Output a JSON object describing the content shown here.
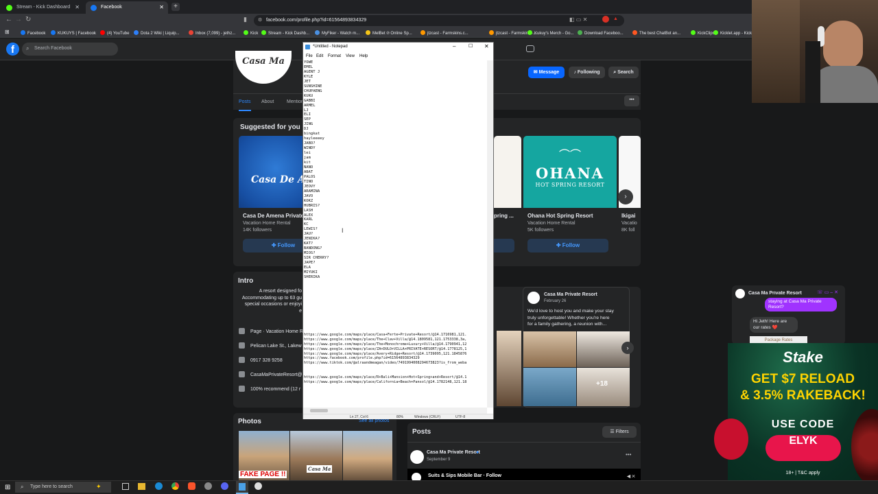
{
  "browser": {
    "tabs": [
      {
        "label": "Stream - Kick Dashboard",
        "icon": "kick-icon",
        "color": "#53fc18"
      },
      {
        "label": "Facebook",
        "icon": "facebook-icon",
        "color": "#1877f2"
      }
    ],
    "url": "facebook.com/profile.php?id=61564893834329",
    "bookmarks": [
      {
        "label": "Facebook",
        "color": "#1877f2"
      },
      {
        "label": "KUKUYS | Facebook",
        "color": "#1877f2"
      },
      {
        "label": "(4) YouTube",
        "color": "#ff0000"
      },
      {
        "label": "Dota 2 Wiki | Liquip...",
        "color": "#2d7ff9"
      },
      {
        "label": "Inbox (7,099) - jethz...",
        "color": "#ea4335"
      },
      {
        "label": "Kick",
        "color": "#53fc18"
      },
      {
        "label": "Stream - Kick Dashb...",
        "color": "#53fc18"
      },
      {
        "label": "MyFiker - Watch m...",
        "color": "#4a90e2"
      },
      {
        "label": "MelBet ℗ Online Sp...",
        "color": "#f5c518"
      },
      {
        "label": "jtzcast - Farmskins.c...",
        "color": "#ff9800"
      },
      {
        "label": "jtzcast - Farmskins -...",
        "color": "#ff9800"
      },
      {
        "label": "Kukuy's Merch - Go...",
        "color": "#53fc18"
      },
      {
        "label": "Download Faceboo...",
        "color": "#4caf50"
      },
      {
        "label": "The best ChatBot an...",
        "color": "#ff5722"
      },
      {
        "label": "KickClips",
        "color": "#53fc18"
      },
      {
        "label": "Kicklet.app - Kick C...",
        "color": "#53fc18"
      }
    ]
  },
  "facebook": {
    "search_placeholder": "Search Facebook",
    "page_avatar_text": "Casa Ma",
    "actions": {
      "message": "Message",
      "following": "Following",
      "search": "Search"
    },
    "tabs": [
      "Posts",
      "About",
      "Mentions"
    ],
    "suggested": {
      "title": "Suggested for you",
      "cards": [
        {
          "name": "Casa De Amena Private",
          "type": "Vacation Home Rental",
          "followers": "14K followers",
          "follow": "Follow",
          "img_text": "Casa De Ar"
        },
        {
          "name": "Ohana Hot Spring Resort",
          "type": "Vacation Home Rental",
          "followers": "5K followers",
          "follow": "Follow",
          "img_text": "OHANA",
          "img_sub": "HOT SPRING RESORT"
        },
        {
          "name": "Ikigai",
          "type": "Vacatio",
          "followers": "8K foll",
          "follow": ""
        }
      ],
      "hidden_card_name": "pring ..."
    },
    "intro": {
      "title": "Intro",
      "description_lines": [
        "A resort designed fo",
        "Accommodating up to 63 gu",
        "special occasions or enjoyi",
        "e"
      ],
      "details": [
        {
          "icon": "flag-icon",
          "text": "Page · Vacation Home R"
        },
        {
          "icon": "location-icon",
          "text": "Pelican Lake St., Lakew"
        },
        {
          "icon": "phone-icon",
          "text": "0917 328 9258"
        },
        {
          "icon": "email-icon",
          "text": "CasaMaPrivateResort@"
        },
        {
          "icon": "star-icon",
          "text": "100% recommend (12 r"
        }
      ]
    },
    "photos": {
      "title": "Photos",
      "see_all": "See all photos",
      "sticker_text": "FAKE PAGE !!"
    },
    "posts": {
      "title": "Posts",
      "filters": "Filters",
      "post_author": "Casa Ma Private Resort",
      "post_date": "September 9",
      "shared_name": "Suits & Sips Mobile Bar · Follow"
    },
    "feed_post": {
      "author": "Casa Ma Private Resort",
      "date": "February 26",
      "text": [
        "We'd love to host you and make your stay",
        "truly unforgettable! Whether you're here",
        "for a family gathering, a reunion with..."
      ],
      "more_count": "+18"
    }
  },
  "notepad": {
    "title": "*Untitled - Notepad",
    "menu": [
      "File",
      "Edit",
      "Format",
      "View",
      "Help"
    ],
    "names": [
      "YOWE",
      "EMEL",
      "AGENT J",
      "KYLE",
      "JET",
      "SUNSHINE",
      "CHUPAENG",
      "KUKU",
      "GABBI",
      "ARMEL",
      "LJ",
      "ELI",
      "SEP",
      "JING",
      "DJ",
      "bingkat",
      "hayleeeey",
      "JABO?",
      "WINDY",
      "lei",
      "jam",
      "kit",
      "NANO",
      "ABAT",
      "PALOS",
      "TINO",
      "JEOVY",
      "ARAMINA",
      "JAVO",
      "KOKZ",
      "HUBRIS?",
      "LASH",
      "ALEX",
      "KARL",
      "KC",
      "LEWIS?",
      "JAU?",
      "JENIKA?",
      "KAT?",
      "BANDONG?",
      "MIOS?",
      "SIR CHERRY?",
      "JAPE?",
      "ELA",
      "MIYUKI",
      "SHERIKA"
    ],
    "urls": [
      "https://www.google.com/maps/place/Casa+Ferte+Private+Resort/@14.1716981,121.",
      "https://www.google.com/maps/place/The+Clav+Villa/@14.1809581,121.1753338,3a,",
      "https://www.google.com/maps/place/The+Monochrome+Luxury+Villa/@14.1790941,12",
      "https://www.google.com/maps/place/ZA+DULO+VILLA+PRIVATE+RESORT/@14.1778125,1",
      "https://www.google.com/maps/place/Avery+Ridge+Resort/@14.1739095,121.1845876",
      "https://www.facebook.com/profile.php?id=61564893834329",
      "https://www.tiktok.com/@alraandmeagan/video/7491994008294673823?is_from_weba",
      "",
      "",
      "https://www.google.com/maps/place/R+Bali+Mansion+Hot+Spring+and+Resort/@14.1",
      "https://www.google.com/maps/place/California+Beach+Pansol/@14.1782148,121.18"
    ],
    "status": {
      "position": "Ln 27, Col 6",
      "zoom": "80%",
      "line_ending": "Windows (CRLF)",
      "encoding": "UTF-8"
    }
  },
  "chat": {
    "name": "Casa Ma Private Resort",
    "bubble_me": "staying at Casa Ma Private Resort?",
    "bubble_them": "Hi Jeth! Here are our rates ❤️",
    "preview_text": "Package Rates"
  },
  "ad": {
    "brand": "Stake",
    "line1": "GET $7 RELOAD",
    "line2": "& 3.5% RAKEBACK!",
    "use_code": "USE CODE",
    "code": "ELYK",
    "disclaimer": "18+ | T&C apply"
  },
  "taskbar": {
    "search_placeholder": "Type here to search"
  }
}
